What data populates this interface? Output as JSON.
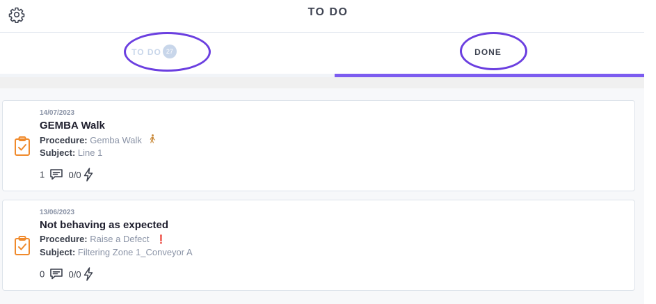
{
  "header": {
    "title": "TO DO",
    "settings_icon": "gear-icon"
  },
  "tabs": {
    "todo": {
      "label": "TO DO",
      "count": "27"
    },
    "done": {
      "label": "DONE"
    }
  },
  "colors": {
    "accent": "#7c5cf0",
    "annotation": "#6b3fe0",
    "clipboard": "#f08a2c"
  },
  "cards": [
    {
      "date": "14/07/2023",
      "title": "GEMBA Walk",
      "procedure_label": "Procedure:",
      "procedure": "Gemba Walk",
      "procedure_icon": "walking-person-icon",
      "subject_label": "Subject:",
      "subject": "Line 1",
      "comments": "1",
      "actions": "0/0"
    },
    {
      "date": "13/06/2023",
      "title": "Not behaving as expected",
      "procedure_label": "Procedure:",
      "procedure": "Raise a Defect",
      "procedure_icon": "exclamation-icon",
      "subject_label": "Subject:",
      "subject": "Filtering Zone 1_Conveyor A",
      "comments": "0",
      "actions": "0/0"
    }
  ]
}
